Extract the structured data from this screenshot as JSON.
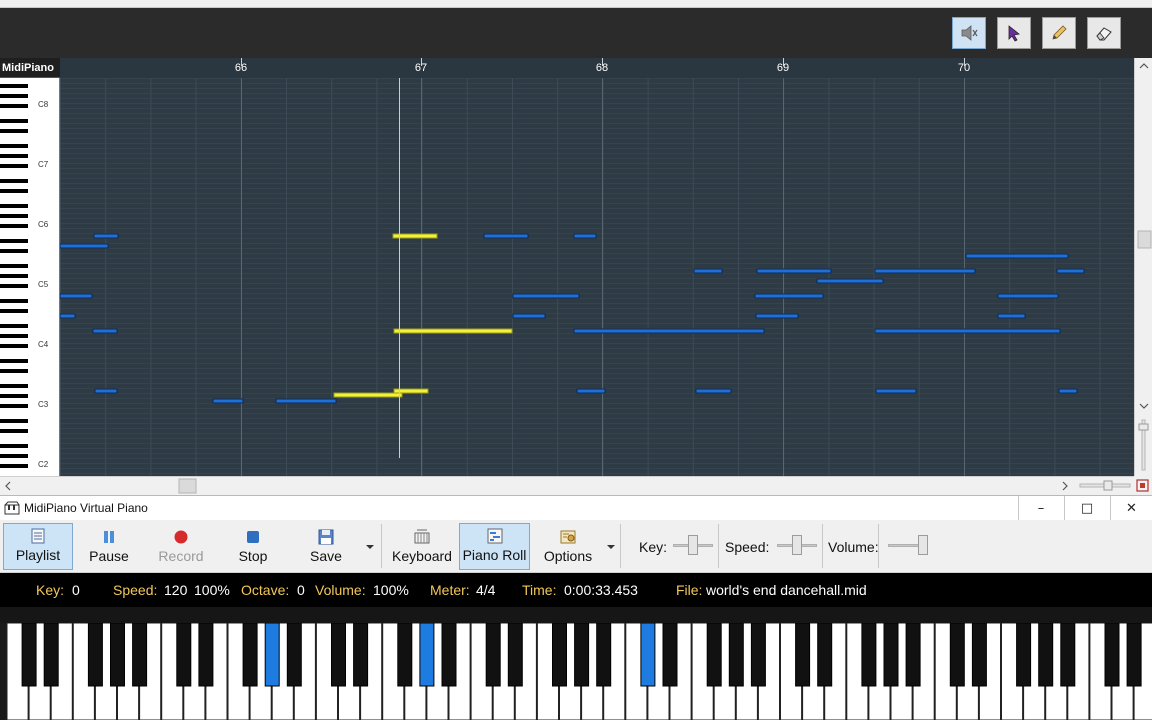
{
  "toolbar_top": {
    "tools": [
      {
        "name": "mute-icon",
        "active": true
      },
      {
        "name": "select-arrow-icon",
        "active": false
      },
      {
        "name": "pencil-icon",
        "active": false
      },
      {
        "name": "eraser-icon",
        "active": false
      }
    ]
  },
  "roll": {
    "label": "MidiPiano",
    "measures": [
      "66",
      "67",
      "68",
      "69",
      "70"
    ],
    "octave_labels": [
      "C8",
      "C7",
      "C6",
      "C5",
      "C4",
      "C3",
      "C2"
    ]
  },
  "window": {
    "title": "MidiPiano Virtual Piano",
    "minimize": "–",
    "maximize": "□",
    "close": "✕"
  },
  "main_toolbar": {
    "playlist": "Playlist",
    "pause": "Pause",
    "record": "Record",
    "stop": "Stop",
    "save": "Save",
    "keyboard": "Keyboard",
    "piano_roll": "Piano Roll",
    "options": "Options",
    "key_label": "Key:",
    "speed_label": "Speed:",
    "volume_label": "Volume:"
  },
  "status": {
    "key_label": "Key:",
    "key_value": "0",
    "speed_label": "Speed:",
    "speed_value": "120",
    "speed_pct": "100%",
    "octave_label": "Octave:",
    "octave_value": "0",
    "volume_label": "Volume:",
    "volume_value": "100%",
    "meter_label": "Meter:",
    "meter_value": "4/4",
    "time_label": "Time:",
    "time_value": "0:00:33.453",
    "file_label": "File:",
    "file_value": "world's end dancehall.mid"
  },
  "colors": {
    "grid_bg": "#2e3b44",
    "note_blue": "#1f6fd6",
    "note_active": "#f2f23a",
    "playhead": "#e8d84a",
    "key_pressed": "#1e7be0",
    "status_label": "#f2c85a"
  }
}
